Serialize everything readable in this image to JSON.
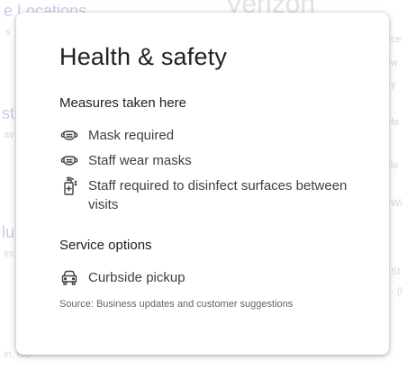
{
  "background": {
    "top_link": "e Locations",
    "title": "Verizon",
    "left_fragments": [
      "s",
      "st",
      "av",
      "lu",
      "es",
      "in, NC"
    ],
    "right_fragments": [
      "ce",
      "w",
      "y",
      "fe",
      "le",
      "Wi",
      "St",
      "· (l"
    ]
  },
  "dialog": {
    "title": "Health & safety",
    "measures": {
      "heading": "Measures taken here",
      "items": [
        {
          "icon": "mask-icon",
          "label": "Mask required"
        },
        {
          "icon": "mask-icon",
          "label": "Staff wear masks"
        },
        {
          "icon": "sanitizer-icon",
          "label": "Staff required to disinfect surfaces between visits"
        }
      ]
    },
    "service": {
      "heading": "Service options",
      "items": [
        {
          "icon": "car-icon",
          "label": "Curbside pickup"
        }
      ]
    },
    "source": "Source: Business updates and customer suggestions"
  },
  "colors": {
    "text_primary": "#202124",
    "text_secondary": "#3c4043",
    "text_muted": "#5f6368",
    "link_faded": "#c9cde8"
  }
}
